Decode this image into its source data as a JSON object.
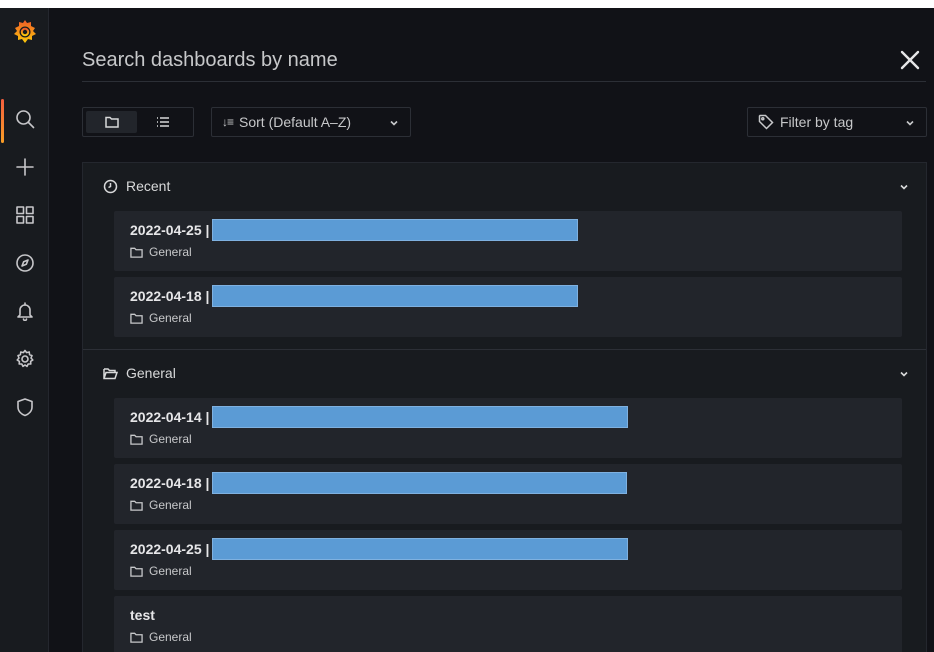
{
  "search": {
    "placeholder": "Search dashboards by name"
  },
  "toolbar": {
    "sort_label": "Sort (Default A–Z)",
    "sort_icon_text": "↓≡",
    "filter_label": "Filter by tag"
  },
  "sections": [
    {
      "title": "Recent",
      "icon": "clock-icon",
      "items": [
        {
          "title": "2022-04-25 |",
          "folder": "General"
        },
        {
          "title": "2022-04-18 |",
          "folder": "General"
        }
      ]
    },
    {
      "title": "General",
      "icon": "folder-open-icon",
      "items": [
        {
          "title": "2022-04-14 |",
          "folder": "General"
        },
        {
          "title": "2022-04-18 |",
          "folder": "General"
        },
        {
          "title": "2022-04-25 |",
          "folder": "General"
        },
        {
          "title": "test",
          "folder": "General"
        }
      ]
    }
  ],
  "colors": {
    "background": "#111217",
    "sidebar": "#181b1f",
    "accent": "#f55f3e",
    "redaction": "#5b9bd5"
  }
}
